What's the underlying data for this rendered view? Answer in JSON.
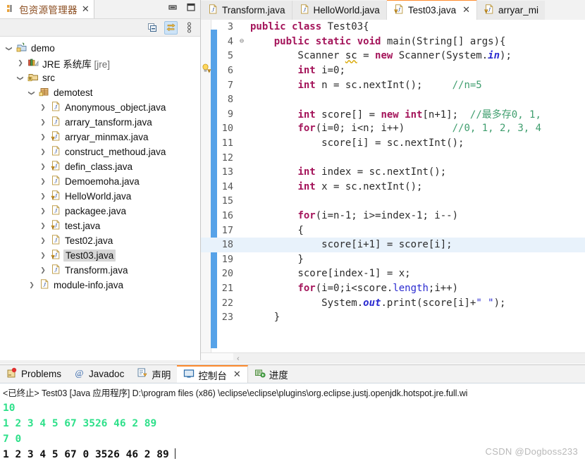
{
  "explorer": {
    "tab_title": "包资源管理器",
    "close_label": "✕",
    "minimize_label": "minimize",
    "maximize_label": "maximize",
    "toolbar": [
      {
        "name": "collapse-all-icon",
        "label": "Collapse All"
      },
      {
        "name": "link-with-editor-icon",
        "label": "Link with Editor"
      },
      {
        "name": "view-menu-icon",
        "label": "View Menu"
      }
    ],
    "tree": [
      {
        "label": "demo",
        "indent": 0,
        "arrow": "v",
        "icon": "java-project-icon",
        "selected": false,
        "suffix": ""
      },
      {
        "label": "JRE 系统库",
        "indent": 1,
        "arrow": ">",
        "icon": "jre-library-icon",
        "selected": false,
        "suffix": "[jre]"
      },
      {
        "label": "src",
        "indent": 1,
        "arrow": "v",
        "icon": "source-folder-icon",
        "selected": false,
        "suffix": ""
      },
      {
        "label": "demotest",
        "indent": 2,
        "arrow": "v",
        "icon": "package-icon",
        "selected": false,
        "suffix": ""
      },
      {
        "label": "Anonymous_object.java",
        "indent": 3,
        "arrow": ">",
        "icon": "java-file-icon",
        "selected": false,
        "suffix": ""
      },
      {
        "label": "arrary_tansform.java",
        "indent": 3,
        "arrow": ">",
        "icon": "java-file-icon",
        "selected": false,
        "suffix": ""
      },
      {
        "label": "arryar_minmax.java",
        "indent": 3,
        "arrow": ">",
        "icon": "java-file-warning-icon",
        "selected": false,
        "suffix": ""
      },
      {
        "label": "construct_methoud.java",
        "indent": 3,
        "arrow": ">",
        "icon": "java-file-icon",
        "selected": false,
        "suffix": ""
      },
      {
        "label": "defin_class.java",
        "indent": 3,
        "arrow": ">",
        "icon": "java-file-warning-icon",
        "selected": false,
        "suffix": ""
      },
      {
        "label": "Demoemoha.java",
        "indent": 3,
        "arrow": ">",
        "icon": "java-file-icon",
        "selected": false,
        "suffix": ""
      },
      {
        "label": "HelloWorld.java",
        "indent": 3,
        "arrow": ">",
        "icon": "java-file-warning-icon",
        "selected": false,
        "suffix": ""
      },
      {
        "label": "packagee.java",
        "indent": 3,
        "arrow": ">",
        "icon": "java-file-icon",
        "selected": false,
        "suffix": ""
      },
      {
        "label": "test.java",
        "indent": 3,
        "arrow": ">",
        "icon": "java-file-warning-icon",
        "selected": false,
        "suffix": ""
      },
      {
        "label": "Test02.java",
        "indent": 3,
        "arrow": ">",
        "icon": "java-file-icon",
        "selected": false,
        "suffix": ""
      },
      {
        "label": "Test03.java",
        "indent": 3,
        "arrow": ">",
        "icon": "java-file-warning-icon",
        "selected": true,
        "suffix": ""
      },
      {
        "label": "Transform.java",
        "indent": 3,
        "arrow": ">",
        "icon": "java-file-icon",
        "selected": false,
        "suffix": ""
      },
      {
        "label": "module-info.java",
        "indent": 2,
        "arrow": ">",
        "icon": "java-file-icon",
        "selected": false,
        "suffix": ""
      }
    ]
  },
  "editor": {
    "tabs": [
      {
        "label": "Transform.java",
        "active": false,
        "warning": false,
        "closable": false
      },
      {
        "label": "HelloWorld.java",
        "active": false,
        "warning": false,
        "closable": false
      },
      {
        "label": "Test03.java",
        "active": true,
        "warning": true,
        "closable": true
      },
      {
        "label": "arryar_mi",
        "active": false,
        "warning": true,
        "closable": false
      }
    ],
    "close_label": "✕",
    "scroll_left_label": "‹",
    "lines": [
      {
        "num": "3",
        "fold": "",
        "highlight": false,
        "tokens": [
          {
            "t": "public ",
            "c": "kw"
          },
          {
            "t": "class ",
            "c": "kw"
          },
          {
            "t": "Test03{",
            "c": "plain"
          }
        ]
      },
      {
        "num": "4",
        "fold": "⊖",
        "highlight": false,
        "tokens": [
          {
            "t": "    ",
            "c": "plain"
          },
          {
            "t": "public static void ",
            "c": "kw"
          },
          {
            "t": "main(String[] args){",
            "c": "plain"
          }
        ]
      },
      {
        "num": "5",
        "fold": "",
        "highlight": false,
        "tokens": [
          {
            "t": "        Scanner ",
            "c": "plain"
          },
          {
            "t": "sc",
            "c": "sq"
          },
          {
            "t": " = ",
            "c": "plain"
          },
          {
            "t": "new ",
            "c": "kw"
          },
          {
            "t": "Scanner(System.",
            "c": "plain"
          },
          {
            "t": "in",
            "c": "fld"
          },
          {
            "t": ");",
            "c": "plain"
          }
        ]
      },
      {
        "num": "6",
        "fold": "",
        "highlight": false,
        "tokens": [
          {
            "t": "        ",
            "c": "plain"
          },
          {
            "t": "int ",
            "c": "kw"
          },
          {
            "t": "i=0;",
            "c": "plain"
          }
        ]
      },
      {
        "num": "7",
        "fold": "",
        "highlight": false,
        "tokens": [
          {
            "t": "        ",
            "c": "plain"
          },
          {
            "t": "int ",
            "c": "kw"
          },
          {
            "t": "n = sc.nextInt();     ",
            "c": "plain"
          },
          {
            "t": "//n=5",
            "c": "cm"
          }
        ]
      },
      {
        "num": "8",
        "fold": "",
        "highlight": false,
        "tokens": []
      },
      {
        "num": "9",
        "fold": "",
        "highlight": false,
        "tokens": [
          {
            "t": "        ",
            "c": "plain"
          },
          {
            "t": "int ",
            "c": "kw"
          },
          {
            "t": "score[] = ",
            "c": "plain"
          },
          {
            "t": "new int",
            "c": "kw"
          },
          {
            "t": "[n+1];  ",
            "c": "plain"
          },
          {
            "t": "//最多存0, 1,",
            "c": "cm"
          }
        ]
      },
      {
        "num": "10",
        "fold": "",
        "highlight": false,
        "tokens": [
          {
            "t": "        ",
            "c": "plain"
          },
          {
            "t": "for",
            "c": "kw"
          },
          {
            "t": "(i=0; i<n; i++)        ",
            "c": "plain"
          },
          {
            "t": "//0, 1, 2, 3, 4",
            "c": "cm"
          }
        ]
      },
      {
        "num": "11",
        "fold": "",
        "highlight": false,
        "tokens": [
          {
            "t": "            score[i] = sc.nextInt();",
            "c": "plain"
          }
        ]
      },
      {
        "num": "12",
        "fold": "",
        "highlight": false,
        "tokens": []
      },
      {
        "num": "13",
        "fold": "",
        "highlight": false,
        "tokens": [
          {
            "t": "        ",
            "c": "plain"
          },
          {
            "t": "int ",
            "c": "kw"
          },
          {
            "t": "index = sc.nextInt();",
            "c": "plain"
          }
        ]
      },
      {
        "num": "14",
        "fold": "",
        "highlight": false,
        "tokens": [
          {
            "t": "        ",
            "c": "plain"
          },
          {
            "t": "int ",
            "c": "kw"
          },
          {
            "t": "x = sc.nextInt();",
            "c": "plain"
          }
        ]
      },
      {
        "num": "15",
        "fold": "",
        "highlight": false,
        "tokens": []
      },
      {
        "num": "16",
        "fold": "",
        "highlight": false,
        "tokens": [
          {
            "t": "        ",
            "c": "plain"
          },
          {
            "t": "for",
            "c": "kw"
          },
          {
            "t": "(i=n-1; i>=index-1; i--)",
            "c": "plain"
          }
        ]
      },
      {
        "num": "17",
        "fold": "",
        "highlight": false,
        "tokens": [
          {
            "t": "        {",
            "c": "plain"
          }
        ]
      },
      {
        "num": "18",
        "fold": "",
        "highlight": true,
        "tokens": [
          {
            "t": "            score[i+1] = score[i];",
            "c": "plain"
          }
        ]
      },
      {
        "num": "19",
        "fold": "",
        "highlight": false,
        "tokens": [
          {
            "t": "        }",
            "c": "plain"
          }
        ]
      },
      {
        "num": "20",
        "fold": "",
        "highlight": false,
        "tokens": [
          {
            "t": "        score[index-1] = x;",
            "c": "plain"
          }
        ]
      },
      {
        "num": "21",
        "fold": "",
        "highlight": false,
        "tokens": [
          {
            "t": "        ",
            "c": "plain"
          },
          {
            "t": "for",
            "c": "kw"
          },
          {
            "t": "(i=0;i<score.",
            "c": "plain"
          },
          {
            "t": "length",
            "c": "lnk"
          },
          {
            "t": ";i++)",
            "c": "plain"
          }
        ]
      },
      {
        "num": "22",
        "fold": "",
        "highlight": false,
        "tokens": [
          {
            "t": "            System.",
            "c": "plain"
          },
          {
            "t": "out",
            "c": "fld"
          },
          {
            "t": ".print(score[i]+",
            "c": "plain"
          },
          {
            "t": "\" \"",
            "c": "str"
          },
          {
            "t": ");",
            "c": "plain"
          }
        ]
      },
      {
        "num": "23",
        "fold": "",
        "highlight": false,
        "tokens": [
          {
            "t": "    }",
            "c": "plain"
          }
        ]
      }
    ]
  },
  "console": {
    "tabs": [
      {
        "label": "Problems",
        "icon": "problems-icon",
        "active": false,
        "closable": false
      },
      {
        "label": "Javadoc",
        "icon": "javadoc-icon",
        "active": false,
        "closable": false
      },
      {
        "label": "声明",
        "icon": "declaration-icon",
        "active": false,
        "closable": false
      },
      {
        "label": "控制台",
        "icon": "console-icon",
        "active": true,
        "closable": true
      },
      {
        "label": "进度",
        "icon": "progress-icon",
        "active": false,
        "closable": false
      }
    ],
    "close_label": "✕",
    "header": "<已终止> Test03 [Java 应用程序] D:\\program files (x86) \\eclipse\\eclipse\\plugins\\org.eclipse.justj.openjdk.hotspot.jre.full.wi",
    "output": [
      {
        "text": "10",
        "kind": "input"
      },
      {
        "text": "1 2 3 4 5 67 3526 46 2 89",
        "kind": "input"
      },
      {
        "text": "7 0",
        "kind": "input"
      },
      {
        "text": "1 2 3 4 5 67 0 3526 46 2 89 ",
        "kind": "output"
      }
    ],
    "colors": {
      "input": "#2ee08a",
      "output": "#101010"
    }
  },
  "watermark": "CSDN @Dogboss233"
}
